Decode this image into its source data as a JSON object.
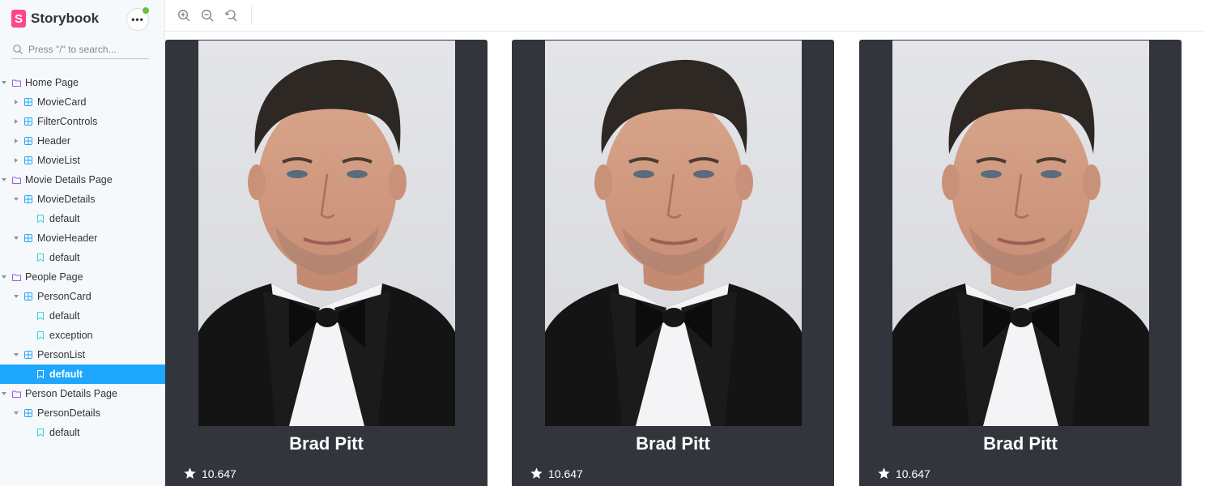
{
  "app": {
    "name": "Storybook",
    "logo_letter": "S",
    "menu_label": "•••"
  },
  "search": {
    "placeholder": "Press \"/\" to search..."
  },
  "tree": [
    {
      "label": "Home Page",
      "type": "group",
      "depth": 0,
      "expanded": true
    },
    {
      "label": "MovieCard",
      "type": "component",
      "depth": 1,
      "expanded": false
    },
    {
      "label": "FilterControls",
      "type": "component",
      "depth": 1,
      "expanded": false
    },
    {
      "label": "Header",
      "type": "component",
      "depth": 1,
      "expanded": false
    },
    {
      "label": "MovieList",
      "type": "component",
      "depth": 1,
      "expanded": false
    },
    {
      "label": "Movie Details Page",
      "type": "group",
      "depth": 0,
      "expanded": true
    },
    {
      "label": "MovieDetails",
      "type": "component",
      "depth": 1,
      "expanded": true
    },
    {
      "label": "default",
      "type": "story",
      "depth": 2
    },
    {
      "label": "MovieHeader",
      "type": "component",
      "depth": 1,
      "expanded": true
    },
    {
      "label": "default",
      "type": "story",
      "depth": 2
    },
    {
      "label": "People Page",
      "type": "group",
      "depth": 0,
      "expanded": true
    },
    {
      "label": "PersonCard",
      "type": "component",
      "depth": 1,
      "expanded": true
    },
    {
      "label": "default",
      "type": "story",
      "depth": 2
    },
    {
      "label": "exception",
      "type": "story",
      "depth": 2
    },
    {
      "label": "PersonList",
      "type": "component",
      "depth": 1,
      "expanded": true
    },
    {
      "label": "default",
      "type": "story",
      "depth": 2,
      "selected": true
    },
    {
      "label": "Person Details Page",
      "type": "group",
      "depth": 0,
      "expanded": true
    },
    {
      "label": "PersonDetails",
      "type": "component",
      "depth": 1,
      "expanded": true
    },
    {
      "label": "default",
      "type": "story",
      "depth": 2
    }
  ],
  "toolbar": {
    "icons": [
      "zoom-in-icon",
      "zoom-out-icon",
      "zoom-reset-icon"
    ]
  },
  "cards": [
    {
      "name": "Brad Pitt",
      "rating": "10.647"
    },
    {
      "name": "Brad Pitt",
      "rating": "10.647"
    },
    {
      "name": "Brad Pitt",
      "rating": "10.647"
    }
  ],
  "colors": {
    "accent": "#1ea7fd",
    "brand": "#ff4785",
    "card_bg": "#32363c",
    "group_icon": "#9b5de5",
    "component_icon": "#1ea7fd",
    "story_icon": "#37d5d3"
  }
}
